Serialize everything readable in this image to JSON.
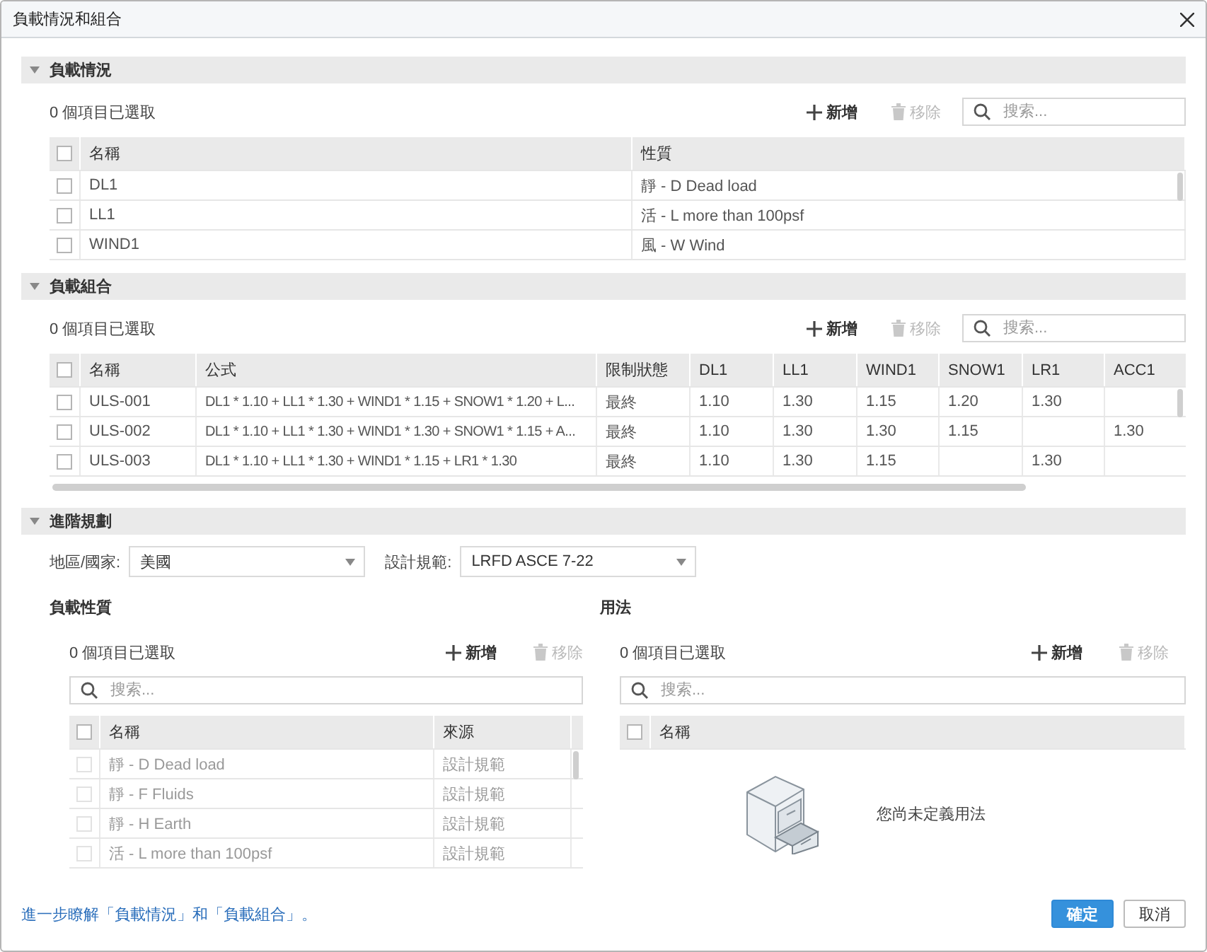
{
  "window": {
    "title": "負載情況和組合"
  },
  "load_cases": {
    "title": "負載情況",
    "expanded": true,
    "selection_count": "0 個項目已選取",
    "add": {
      "label": "新增",
      "disabled": false
    },
    "remove": {
      "label": "移除",
      "disabled": true
    },
    "search": {
      "placeholder": "搜索..."
    },
    "header_checked": false,
    "columns": [
      "名稱",
      "性質"
    ],
    "rows": [
      {
        "checked": false,
        "cells": [
          "DL1",
          "靜 - D Dead load"
        ]
      },
      {
        "checked": false,
        "cells": [
          "LL1",
          "活 - L more than 100psf"
        ]
      },
      {
        "checked": false,
        "cells": [
          "WIND1",
          "風 - W Wind"
        ]
      }
    ]
  },
  "load_combinations": {
    "title": "負載組合",
    "expanded": true,
    "selection_count": "0 個項目已選取",
    "add": {
      "label": "新增",
      "disabled": false
    },
    "remove": {
      "label": "移除",
      "disabled": true
    },
    "search": {
      "placeholder": "搜索..."
    },
    "header_checked": false,
    "columns": [
      "名稱",
      "公式",
      "限制狀態",
      "DL1",
      "LL1",
      "WIND1",
      "SNOW1",
      "LR1",
      "ACC1"
    ],
    "rows": [
      {
        "checked": false,
        "cells": [
          "ULS-001",
          "DL1 * 1.10 + LL1 * 1.30 + WIND1 * 1.15 + SNOW1 * 1.20 + L...",
          "最終",
          "1.10",
          "1.30",
          "1.15",
          "1.20",
          "1.30",
          ""
        ]
      },
      {
        "checked": false,
        "cells": [
          "ULS-002",
          "DL1 * 1.10 + LL1 * 1.30 + WIND1 * 1.30 + SNOW1 * 1.15 + A...",
          "最終",
          "1.10",
          "1.30",
          "1.30",
          "1.15",
          "",
          "1.30"
        ]
      },
      {
        "checked": false,
        "cells": [
          "ULS-003",
          "DL1 * 1.10 + LL1 * 1.30 + WIND1 * 1.15 + LR1 * 1.30",
          "最終",
          "1.10",
          "1.30",
          "1.15",
          "",
          "1.30",
          ""
        ]
      }
    ]
  },
  "advanced": {
    "title": "進階規劃",
    "expanded": true,
    "region": {
      "label": "地區/國家:",
      "value": "美國"
    },
    "design_code": {
      "label": "設計規範:",
      "value": "LRFD ASCE 7-22"
    },
    "load_natures": {
      "title": "負載性質",
      "selection_count": "0 個項目已選取",
      "add": {
        "label": "新增",
        "disabled": false
      },
      "remove": {
        "label": "移除",
        "disabled": true
      },
      "search": {
        "placeholder": "搜索..."
      },
      "header_checked": false,
      "columns": [
        "名稱",
        "來源"
      ],
      "rows": [
        {
          "checked": false,
          "disabled": true,
          "cells": [
            "靜 - D Dead load",
            "設計規範"
          ]
        },
        {
          "checked": false,
          "disabled": true,
          "cells": [
            "靜 - F Fluids",
            "設計規範"
          ]
        },
        {
          "checked": false,
          "disabled": true,
          "cells": [
            "靜 - H Earth",
            "設計規範"
          ]
        },
        {
          "checked": false,
          "disabled": true,
          "cells": [
            "活 - L more than 100psf",
            "設計規範"
          ]
        }
      ]
    },
    "usages": {
      "title": "用法",
      "selection_count": "0 個項目已選取",
      "add": {
        "label": "新增",
        "disabled": false
      },
      "remove": {
        "label": "移除",
        "disabled": true
      },
      "search": {
        "placeholder": "搜索..."
      },
      "header_checked": false,
      "columns": [
        "名稱"
      ],
      "empty_message": "您尚未定義用法"
    }
  },
  "footer": {
    "link": "進一步瞭解「負載情況」和「負載組合」。",
    "ok": "確定",
    "cancel": "取消"
  }
}
